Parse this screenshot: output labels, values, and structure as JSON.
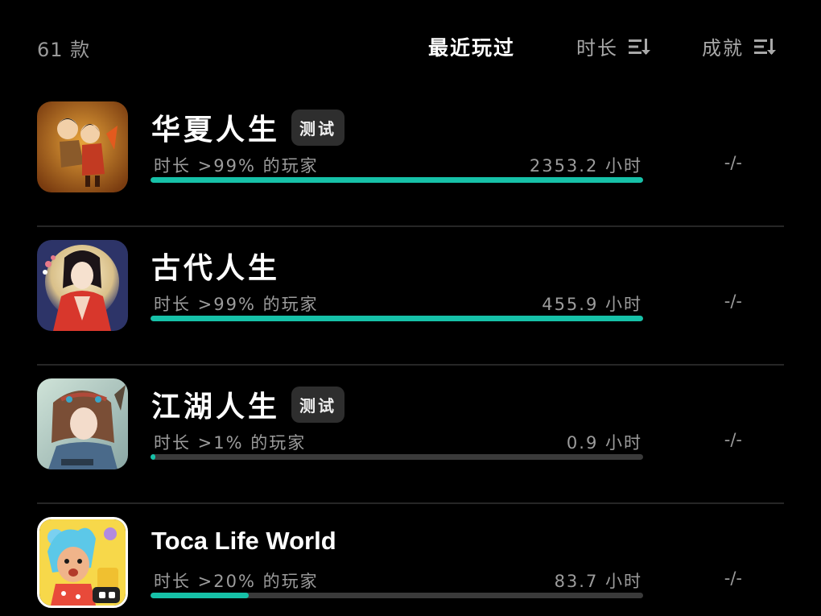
{
  "header": {
    "count_label": "61 款",
    "sort_recent": "最近玩过",
    "sort_time": "时长",
    "sort_achievement": "成就"
  },
  "colors": {
    "background": "#000000",
    "accent": "#16c1a8",
    "track": "#3a3a3a",
    "badge_bg": "#2e2e2e",
    "muted_text": "#9c9c9c"
  },
  "games": [
    {
      "title": "华夏人生",
      "badge": "测试",
      "stat": "时长 >99% 的玩家",
      "hours": "2353.2 小时",
      "achievement": "-/-",
      "progress": 1.0,
      "icon": "huaxia-rensheng-app-icon"
    },
    {
      "title": "古代人生",
      "badge": "",
      "stat": "时长 >99% 的玩家",
      "hours": "455.9 小时",
      "achievement": "-/-",
      "progress": 1.0,
      "icon": "gudai-rensheng-app-icon"
    },
    {
      "title": "江湖人生",
      "badge": "测试",
      "stat": "时长 >1% 的玩家",
      "hours": "0.9 小时",
      "achievement": "-/-",
      "progress": 0.01,
      "icon": "jianghu-rensheng-app-icon"
    },
    {
      "title": "Toca Life World",
      "badge": "",
      "stat": "时长 >20% 的玩家",
      "hours": "83.7 小时",
      "achievement": "-/-",
      "progress": 0.2,
      "icon": "toca-life-world-app-icon"
    }
  ]
}
